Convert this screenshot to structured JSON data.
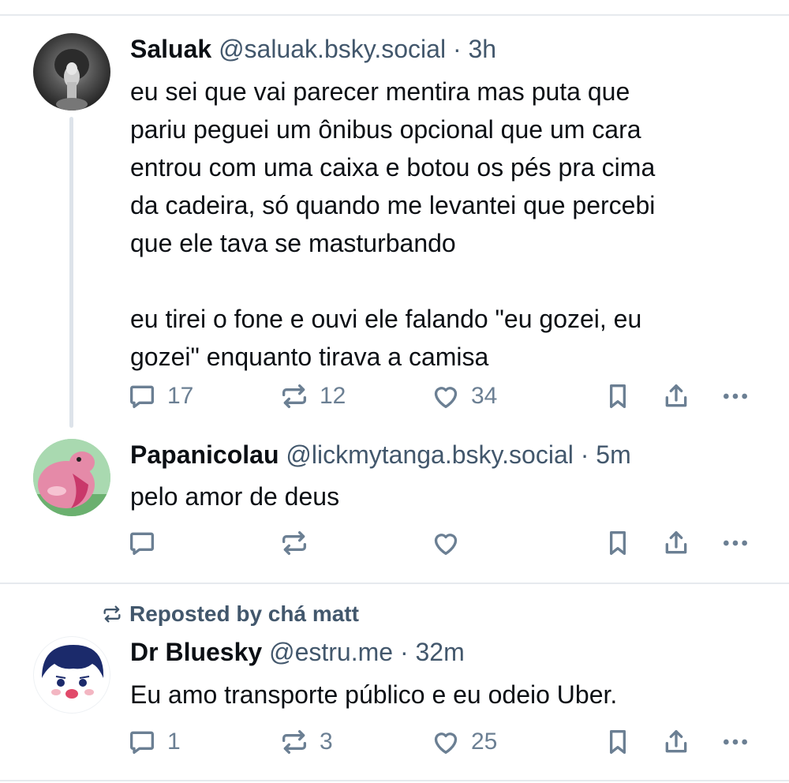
{
  "posts": [
    {
      "name": "Saluak",
      "handle": "@saluak.bsky.social",
      "separator": "·",
      "time": "3h",
      "text": "eu sei que vai parecer mentira mas puta que\npariu peguei um ônibus opcional que um cara\nentrou com uma caixa e botou os pés pra cima\nda cadeira, só quando me levantei que percebi\nque ele tava se masturbando\n\neu tirei o fone e ouvi ele falando \"eu gozei, eu\ngozei\" enquanto tirava a camisa",
      "replies": "17",
      "reposts": "12",
      "likes": "34"
    },
    {
      "name": "Papanicolau",
      "handle": "@lickmytanga.bsky.social",
      "separator": "·",
      "time": "5m",
      "text": "pelo amor de deus",
      "replies": "",
      "reposts": "",
      "likes": ""
    },
    {
      "repost_label": "Reposted by chá matt",
      "name": "Dr Bluesky",
      "handle": "@estru.me",
      "separator": "·",
      "time": "32m",
      "text": "Eu amo transporte público e eu odeio Uber.",
      "replies": "1",
      "reposts": "3",
      "likes": "25"
    }
  ],
  "icons": {
    "reply": "reply-icon",
    "repost": "repost-icon",
    "like": "heart-icon",
    "bookmark": "bookmark-icon",
    "share": "share-icon",
    "more": "more-icon"
  },
  "colors": {
    "text": "#0b0f14",
    "secondary": "#42576c",
    "icon": "#6b7f93",
    "divider": "#e6eaee"
  }
}
